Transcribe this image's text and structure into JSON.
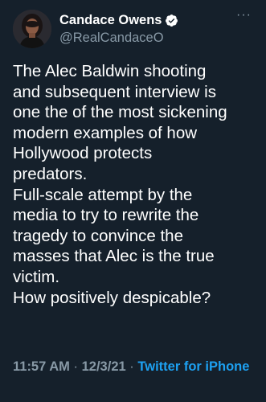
{
  "author": {
    "display_name": "Candace Owens",
    "handle": "@RealCandaceO",
    "verified": true,
    "verified_color": "#1da1f2"
  },
  "more_icon": "more-horizontal-icon",
  "tweet": {
    "text": "The Alec Baldwin shooting\nand subsequent interview is\none the of the most sickening\nmodern examples of how\nHollywood protects\npredators.\nFull-scale attempt by the\nmedia to try to rewrite the\ntragedy to convince the\nmasses that Alec is the true\nvictim.\nHow positively despicable?"
  },
  "meta": {
    "time": "11:57 AM",
    "separator": "·",
    "date": "12/3/21",
    "source": "Twitter for iPhone"
  },
  "colors": {
    "background": "#15202b",
    "secondary_text": "#8899a6",
    "link": "#1da1f2"
  }
}
